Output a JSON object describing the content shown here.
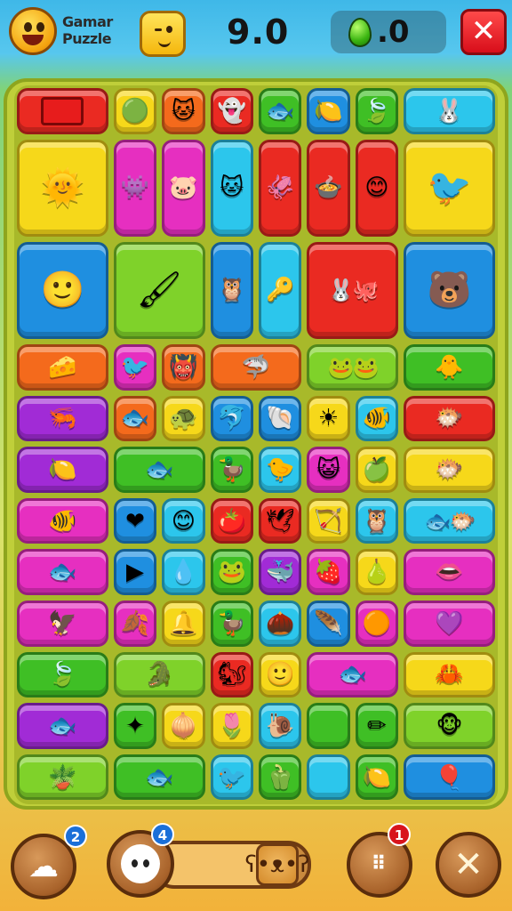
{
  "header": {
    "app_title": "Gamar Puzzle",
    "score": "9.0",
    "gems": ".0",
    "close_label": "✕"
  },
  "colors": {
    "red": "#ea2a22",
    "yellow": "#f6d81a",
    "orange": "#f46a1c",
    "green": "#3fbf25",
    "cyan": "#2cc6ec",
    "blue": "#1f8fe0",
    "purple": "#a12bd6",
    "magenta": "#e62fc0",
    "lime": "#7fd22a",
    "pink": "#f25d9a"
  },
  "board": {
    "tiles": [
      {
        "col": 0,
        "row": 0,
        "w": 2,
        "h": 1,
        "color": "red",
        "icon": "square-icon",
        "glyph": ""
      },
      {
        "col": 2,
        "row": 0,
        "w": 1,
        "h": 1,
        "color": "yellow",
        "icon": "green-blob-icon",
        "glyph": "🟢"
      },
      {
        "col": 3,
        "row": 0,
        "w": 1,
        "h": 1,
        "color": "orange",
        "icon": "cat-face-icon",
        "glyph": "🐱"
      },
      {
        "col": 4,
        "row": 0,
        "w": 1,
        "h": 1,
        "color": "red",
        "icon": "ghost-icon",
        "glyph": "👻"
      },
      {
        "col": 5,
        "row": 0,
        "w": 1,
        "h": 1,
        "color": "green",
        "icon": "fish-face-icon",
        "glyph": "🐟"
      },
      {
        "col": 6,
        "row": 0,
        "w": 1,
        "h": 1,
        "color": "blue",
        "icon": "lemon-icon",
        "glyph": "🍋"
      },
      {
        "col": 7,
        "row": 0,
        "w": 1,
        "h": 1,
        "color": "green",
        "icon": "leaf-icon",
        "glyph": "🍃"
      },
      {
        "col": 8,
        "row": 0,
        "w": 2,
        "h": 1,
        "color": "cyan",
        "icon": "bunny-icon",
        "glyph": "🐰"
      },
      {
        "col": 0,
        "row": 1,
        "w": 2,
        "h": 2,
        "color": "yellow",
        "icon": "sun-creature-icon",
        "glyph": "🌞",
        "big": true
      },
      {
        "col": 2,
        "row": 1,
        "w": 1,
        "h": 2,
        "color": "magenta",
        "icon": "purple-creature-icon",
        "glyph": "👾"
      },
      {
        "col": 3,
        "row": 1,
        "w": 1,
        "h": 2,
        "color": "magenta",
        "icon": "pink-creature-icon",
        "glyph": "🐷"
      },
      {
        "col": 4,
        "row": 1,
        "w": 1,
        "h": 2,
        "color": "cyan",
        "icon": "cat-creature-icon",
        "glyph": "🐱"
      },
      {
        "col": 5,
        "row": 1,
        "w": 1,
        "h": 2,
        "color": "red",
        "icon": "squid-icon",
        "glyph": "🦑"
      },
      {
        "col": 6,
        "row": 1,
        "w": 1,
        "h": 2,
        "color": "red",
        "icon": "cauldron-icon",
        "glyph": "🍲"
      },
      {
        "col": 7,
        "row": 1,
        "w": 1,
        "h": 2,
        "color": "red",
        "icon": "blob-face-icon",
        "glyph": "😊"
      },
      {
        "col": 8,
        "row": 1,
        "w": 2,
        "h": 2,
        "color": "yellow",
        "icon": "bird-icon",
        "glyph": "🐦",
        "big": true
      },
      {
        "col": 0,
        "row": 3,
        "w": 2,
        "h": 2,
        "color": "blue",
        "icon": "blue-creature-icon",
        "glyph": "🙂",
        "big": true
      },
      {
        "col": 2,
        "row": 3,
        "w": 2,
        "h": 2,
        "color": "lime",
        "icon": "brush-icon",
        "glyph": "🖌",
        "big": true
      },
      {
        "col": 4,
        "row": 3,
        "w": 1,
        "h": 2,
        "color": "blue",
        "icon": "owl-icon",
        "glyph": "🦉"
      },
      {
        "col": 5,
        "row": 3,
        "w": 1,
        "h": 2,
        "color": "cyan",
        "icon": "key-icon",
        "glyph": "🔑"
      },
      {
        "col": 6,
        "row": 3,
        "w": 2,
        "h": 2,
        "color": "red",
        "icon": "twin-creatures-icon",
        "glyph": "🐰🐙",
        "pair": true
      },
      {
        "col": 8,
        "row": 3,
        "w": 2,
        "h": 2,
        "color": "blue",
        "icon": "bear-icon",
        "glyph": "🐻",
        "big": true
      },
      {
        "col": 0,
        "row": 5,
        "w": 2,
        "h": 1,
        "color": "orange",
        "icon": "cheese-icon",
        "glyph": "🧀"
      },
      {
        "col": 2,
        "row": 5,
        "w": 1,
        "h": 1,
        "color": "magenta",
        "icon": "blue-bird-icon",
        "glyph": "🐦"
      },
      {
        "col": 3,
        "row": 5,
        "w": 1,
        "h": 1,
        "color": "orange",
        "icon": "monster-icon",
        "glyph": "👹"
      },
      {
        "col": 4,
        "row": 5,
        "w": 2,
        "h": 1,
        "color": "orange",
        "icon": "shark-icon",
        "glyph": "🦈"
      },
      {
        "col": 6,
        "row": 5,
        "w": 2,
        "h": 1,
        "color": "lime",
        "icon": "frogs-icon",
        "glyph": "🐸🐸",
        "pair": true
      },
      {
        "col": 8,
        "row": 5,
        "w": 2,
        "h": 1,
        "color": "green",
        "icon": "chick-icon",
        "glyph": "🐥"
      },
      {
        "col": 0,
        "row": 6,
        "w": 2,
        "h": 1,
        "color": "purple",
        "icon": "shrimp-icon",
        "glyph": "🦐"
      },
      {
        "col": 2,
        "row": 6,
        "w": 1,
        "h": 1,
        "color": "orange",
        "icon": "blue-fish-icon",
        "glyph": "🐟"
      },
      {
        "col": 3,
        "row": 6,
        "w": 1,
        "h": 1,
        "color": "yellow",
        "icon": "turtle-icon",
        "glyph": "🐢"
      },
      {
        "col": 4,
        "row": 6,
        "w": 1,
        "h": 1,
        "color": "blue",
        "icon": "dolphin-icon",
        "glyph": "🐬"
      },
      {
        "col": 5,
        "row": 6,
        "w": 1,
        "h": 1,
        "color": "blue",
        "icon": "shell-icon",
        "glyph": "🐚"
      },
      {
        "col": 6,
        "row": 6,
        "w": 1,
        "h": 1,
        "color": "yellow",
        "icon": "sun-icon",
        "glyph": "☀"
      },
      {
        "col": 7,
        "row": 6,
        "w": 1,
        "h": 1,
        "color": "cyan",
        "icon": "goldfish-icon",
        "glyph": "🐠"
      },
      {
        "col": 8,
        "row": 6,
        "w": 2,
        "h": 1,
        "color": "red",
        "icon": "red-fish-icon",
        "glyph": "🐡"
      },
      {
        "col": 0,
        "row": 7,
        "w": 2,
        "h": 1,
        "color": "purple",
        "icon": "lemon-slice-icon",
        "glyph": "🍋"
      },
      {
        "col": 2,
        "row": 7,
        "w": 2,
        "h": 1,
        "color": "green",
        "icon": "pike-icon",
        "glyph": "🐟"
      },
      {
        "col": 4,
        "row": 7,
        "w": 1,
        "h": 1,
        "color": "green",
        "icon": "duck-icon",
        "glyph": "🦆"
      },
      {
        "col": 5,
        "row": 7,
        "w": 1,
        "h": 1,
        "color": "cyan",
        "icon": "chick-small-icon",
        "glyph": "🐤"
      },
      {
        "col": 6,
        "row": 7,
        "w": 1,
        "h": 1,
        "color": "magenta",
        "icon": "purple-face-icon",
        "glyph": "😺"
      },
      {
        "col": 7,
        "row": 7,
        "w": 1,
        "h": 1,
        "color": "yellow",
        "icon": "apple-icon",
        "glyph": "🍏"
      },
      {
        "col": 8,
        "row": 7,
        "w": 2,
        "h": 1,
        "color": "yellow",
        "icon": "red-ball-fish-icon",
        "glyph": "🐡"
      },
      {
        "col": 0,
        "row": 8,
        "w": 2,
        "h": 1,
        "color": "magenta",
        "icon": "swordfish-icon",
        "glyph": "🐠"
      },
      {
        "col": 2,
        "row": 8,
        "w": 1,
        "h": 1,
        "color": "blue",
        "icon": "heart-fish-icon",
        "glyph": "❤"
      },
      {
        "col": 3,
        "row": 8,
        "w": 1,
        "h": 1,
        "color": "cyan",
        "icon": "red-face-icon",
        "glyph": "😊"
      },
      {
        "col": 4,
        "row": 8,
        "w": 1,
        "h": 1,
        "color": "red",
        "icon": "tomato-icon",
        "glyph": "🍅"
      },
      {
        "col": 5,
        "row": 8,
        "w": 1,
        "h": 1,
        "color": "red",
        "icon": "bird-wing-icon",
        "glyph": "🕊"
      },
      {
        "col": 6,
        "row": 8,
        "w": 1,
        "h": 1,
        "color": "yellow",
        "icon": "bow-icon",
        "glyph": "🏹"
      },
      {
        "col": 7,
        "row": 8,
        "w": 1,
        "h": 1,
        "color": "cyan",
        "icon": "owl-small-icon",
        "glyph": "🦉"
      },
      {
        "col": 8,
        "row": 8,
        "w": 2,
        "h": 1,
        "color": "cyan",
        "icon": "twin-fish-icon",
        "glyph": "🐟🐡",
        "pair": true
      },
      {
        "col": 0,
        "row": 9,
        "w": 2,
        "h": 1,
        "color": "magenta",
        "icon": "goldfish-long-icon",
        "glyph": "🐟"
      },
      {
        "col": 2,
        "row": 9,
        "w": 1,
        "h": 1,
        "color": "blue",
        "icon": "triangle-icon",
        "glyph": "▶"
      },
      {
        "col": 3,
        "row": 9,
        "w": 1,
        "h": 1,
        "color": "cyan",
        "icon": "drop-icon",
        "glyph": "💧"
      },
      {
        "col": 4,
        "row": 9,
        "w": 1,
        "h": 1,
        "color": "green",
        "icon": "frog-face-icon",
        "glyph": "🐸"
      },
      {
        "col": 5,
        "row": 9,
        "w": 1,
        "h": 1,
        "color": "purple",
        "icon": "whale-icon",
        "glyph": "🐳"
      },
      {
        "col": 6,
        "row": 9,
        "w": 1,
        "h": 1,
        "color": "magenta",
        "icon": "berry-icon",
        "glyph": "🍓"
      },
      {
        "col": 7,
        "row": 9,
        "w": 1,
        "h": 1,
        "color": "yellow",
        "icon": "pear-icon",
        "glyph": "🍐"
      },
      {
        "col": 8,
        "row": 9,
        "w": 2,
        "h": 1,
        "color": "magenta",
        "icon": "lips-icon",
        "glyph": "👄"
      },
      {
        "col": 0,
        "row": 10,
        "w": 2,
        "h": 1,
        "color": "magenta",
        "icon": "phoenix-icon",
        "glyph": "🦅"
      },
      {
        "col": 2,
        "row": 10,
        "w": 1,
        "h": 1,
        "color": "magenta",
        "icon": "leaf-orange-icon",
        "glyph": "🍂"
      },
      {
        "col": 3,
        "row": 10,
        "w": 1,
        "h": 1,
        "color": "yellow",
        "icon": "bell-icon",
        "glyph": "🔔"
      },
      {
        "col": 4,
        "row": 10,
        "w": 1,
        "h": 1,
        "color": "green",
        "icon": "rubber-duck-icon",
        "glyph": "🦆"
      },
      {
        "col": 5,
        "row": 10,
        "w": 1,
        "h": 1,
        "color": "cyan",
        "icon": "acorn-icon",
        "glyph": "🌰"
      },
      {
        "col": 6,
        "row": 10,
        "w": 1,
        "h": 1,
        "color": "blue",
        "icon": "feather-icon",
        "glyph": "🪶"
      },
      {
        "col": 7,
        "row": 10,
        "w": 1,
        "h": 1,
        "color": "magenta",
        "icon": "orange-face-icon",
        "glyph": "🟠"
      },
      {
        "col": 8,
        "row": 10,
        "w": 2,
        "h": 1,
        "color": "magenta",
        "icon": "purple-heart-icon",
        "glyph": "💜"
      },
      {
        "col": 0,
        "row": 11,
        "w": 2,
        "h": 1,
        "color": "green",
        "icon": "leaf-ball-icon",
        "glyph": "🍃"
      },
      {
        "col": 2,
        "row": 11,
        "w": 2,
        "h": 1,
        "color": "lime",
        "icon": "crocodile-icon",
        "glyph": "🐊"
      },
      {
        "col": 4,
        "row": 11,
        "w": 1,
        "h": 1,
        "color": "red",
        "icon": "squirrel-icon",
        "glyph": "🐿"
      },
      {
        "col": 5,
        "row": 11,
        "w": 1,
        "h": 1,
        "color": "yellow",
        "icon": "smiley-icon",
        "glyph": "🙂"
      },
      {
        "col": 6,
        "row": 11,
        "w": 2,
        "h": 1,
        "color": "magenta",
        "icon": "leaf-fish-icon",
        "glyph": "🐟"
      },
      {
        "col": 8,
        "row": 11,
        "w": 2,
        "h": 1,
        "color": "yellow",
        "icon": "crab-icon",
        "glyph": "🦀"
      },
      {
        "col": 0,
        "row": 12,
        "w": 2,
        "h": 1,
        "color": "purple",
        "icon": "flatfish-icon",
        "glyph": "🐟"
      },
      {
        "col": 2,
        "row": 12,
        "w": 1,
        "h": 1,
        "color": "green",
        "icon": "star-icon",
        "glyph": "✦"
      },
      {
        "col": 3,
        "row": 12,
        "w": 1,
        "h": 1,
        "color": "yellow",
        "icon": "onion-icon",
        "glyph": "🧅"
      },
      {
        "col": 4,
        "row": 12,
        "w": 1,
        "h": 1,
        "color": "yellow",
        "icon": "flower-icon",
        "glyph": "🌷"
      },
      {
        "col": 5,
        "row": 12,
        "w": 1,
        "h": 1,
        "color": "cyan",
        "icon": "snail-icon",
        "glyph": "🐌"
      },
      {
        "col": 6,
        "row": 12,
        "w": 1,
        "h": 1,
        "color": "green",
        "icon": "blank-icon",
        "glyph": ""
      },
      {
        "col": 7,
        "row": 12,
        "w": 1,
        "h": 1,
        "color": "green",
        "icon": "pencil-icon",
        "glyph": "✏"
      },
      {
        "col": 8,
        "row": 12,
        "w": 2,
        "h": 1,
        "color": "lime",
        "icon": "monkey-icon",
        "glyph": "🐵"
      },
      {
        "col": 0,
        "row": 13,
        "w": 2,
        "h": 1,
        "color": "lime",
        "icon": "plant-pot-icon",
        "glyph": "🪴"
      },
      {
        "col": 2,
        "row": 13,
        "w": 2,
        "h": 1,
        "color": "green",
        "icon": "catfish-icon",
        "glyph": "🐟"
      },
      {
        "col": 4,
        "row": 13,
        "w": 1,
        "h": 1,
        "color": "cyan",
        "icon": "bluebird-icon",
        "glyph": "🐦"
      },
      {
        "col": 5,
        "row": 13,
        "w": 1,
        "h": 1,
        "color": "green",
        "icon": "pepper-icon",
        "glyph": "🫑"
      },
      {
        "col": 6,
        "row": 13,
        "w": 1,
        "h": 1,
        "color": "cyan",
        "icon": "blank-icon",
        "glyph": ""
      },
      {
        "col": 7,
        "row": 13,
        "w": 1,
        "h": 1,
        "color": "green",
        "icon": "lemon-face-icon",
        "glyph": "🍋"
      },
      {
        "col": 8,
        "row": 13,
        "w": 2,
        "h": 1,
        "color": "blue",
        "icon": "balloon-icon",
        "glyph": "🎈"
      }
    ]
  },
  "bottom": {
    "left_badge": "2",
    "face_badge": "4",
    "grid_badge": "1",
    "left_icon": "sheep-icon",
    "face_icon": "smile-face-icon",
    "bear_icon": "bear-face-icon",
    "grid_icon": "grid-dots-icon",
    "tools_icon": "tools-icon",
    "progress": 0.72
  }
}
